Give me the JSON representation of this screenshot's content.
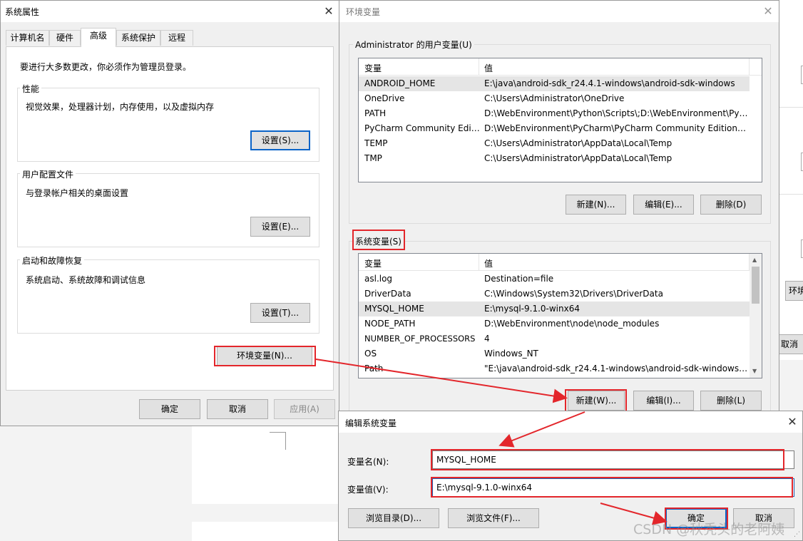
{
  "system_props": {
    "title": "系统属性",
    "tabs": [
      "计算机名",
      "硬件",
      "高级",
      "系统保护",
      "远程"
    ],
    "admin_notice": "要进行大多数更改，你必须作为管理员登录。",
    "perf": {
      "label": "性能",
      "desc": "视觉效果，处理器计划，内存使用，以及虚拟内存",
      "button": "设置(S)..."
    },
    "profile": {
      "label": "用户配置文件",
      "desc": "与登录帐户相关的桌面设置",
      "button": "设置(E)..."
    },
    "startup": {
      "label": "启动和故障恢复",
      "desc": "系统启动、系统故障和调试信息",
      "button": "设置(T)..."
    },
    "env_button": "环境变量(N)...",
    "ok": "确定",
    "cancel": "取消",
    "apply": "应用(A)"
  },
  "env_vars": {
    "title": "环境变量",
    "user_group": "Administrator 的用户变量(U)",
    "col_var": "变量",
    "col_val": "值",
    "user_rows": [
      {
        "name": "ANDROID_HOME",
        "value": "E:\\java\\android-sdk_r24.4.1-windows\\android-sdk-windows"
      },
      {
        "name": "OneDrive",
        "value": "C:\\Users\\Administrator\\OneDrive"
      },
      {
        "name": "PATH",
        "value": "D:\\WebEnvironment\\Python\\Scripts\\;D:\\WebEnvironment\\Pyth..."
      },
      {
        "name": "PyCharm Community Editi...",
        "value": "D:\\WebEnvironment\\PyCharm\\PyCharm Community Edition 2..."
      },
      {
        "name": "TEMP",
        "value": "C:\\Users\\Administrator\\AppData\\Local\\Temp"
      },
      {
        "name": "TMP",
        "value": "C:\\Users\\Administrator\\AppData\\Local\\Temp"
      }
    ],
    "user_buttons": {
      "new": "新建(N)...",
      "edit": "编辑(E)...",
      "delete": "删除(D)"
    },
    "sys_group": "系统变量(S)",
    "sys_rows": [
      {
        "name": "asl.log",
        "value": "Destination=file"
      },
      {
        "name": "DriverData",
        "value": "C:\\Windows\\System32\\Drivers\\DriverData"
      },
      {
        "name": "MYSQL_HOME",
        "value": "E:\\mysql-9.1.0-winx64"
      },
      {
        "name": "NODE_PATH",
        "value": "D:\\WebEnvironment\\node\\node_modules"
      },
      {
        "name": "NUMBER_OF_PROCESSORS",
        "value": "4"
      },
      {
        "name": "OS",
        "value": "Windows_NT"
      },
      {
        "name": "Path",
        "value": "\"E:\\java\\android-sdk_r24.4.1-windows\\android-sdk-windows\\..."
      }
    ],
    "sys_buttons": {
      "new": "新建(W)...",
      "edit": "编辑(I)...",
      "delete": "删除(L)"
    }
  },
  "edit_dialog": {
    "title": "编辑系统变量",
    "name_label": "变量名(N):",
    "name_value": "MYSQL_HOME",
    "value_label": "变量值(V):",
    "value_value": "E:\\mysql-9.1.0-winx64",
    "browse_dir": "浏览目录(D)...",
    "browse_file": "浏览文件(F)...",
    "ok": "确定",
    "cancel": "取消"
  },
  "bg": {
    "btn_env": "环境",
    "btn_cancel": "取消"
  },
  "watermark": "CSDN @秋秃头的老阿姨",
  "colors": {
    "highlight": "#e3262b",
    "focus": "#0a64c8"
  }
}
